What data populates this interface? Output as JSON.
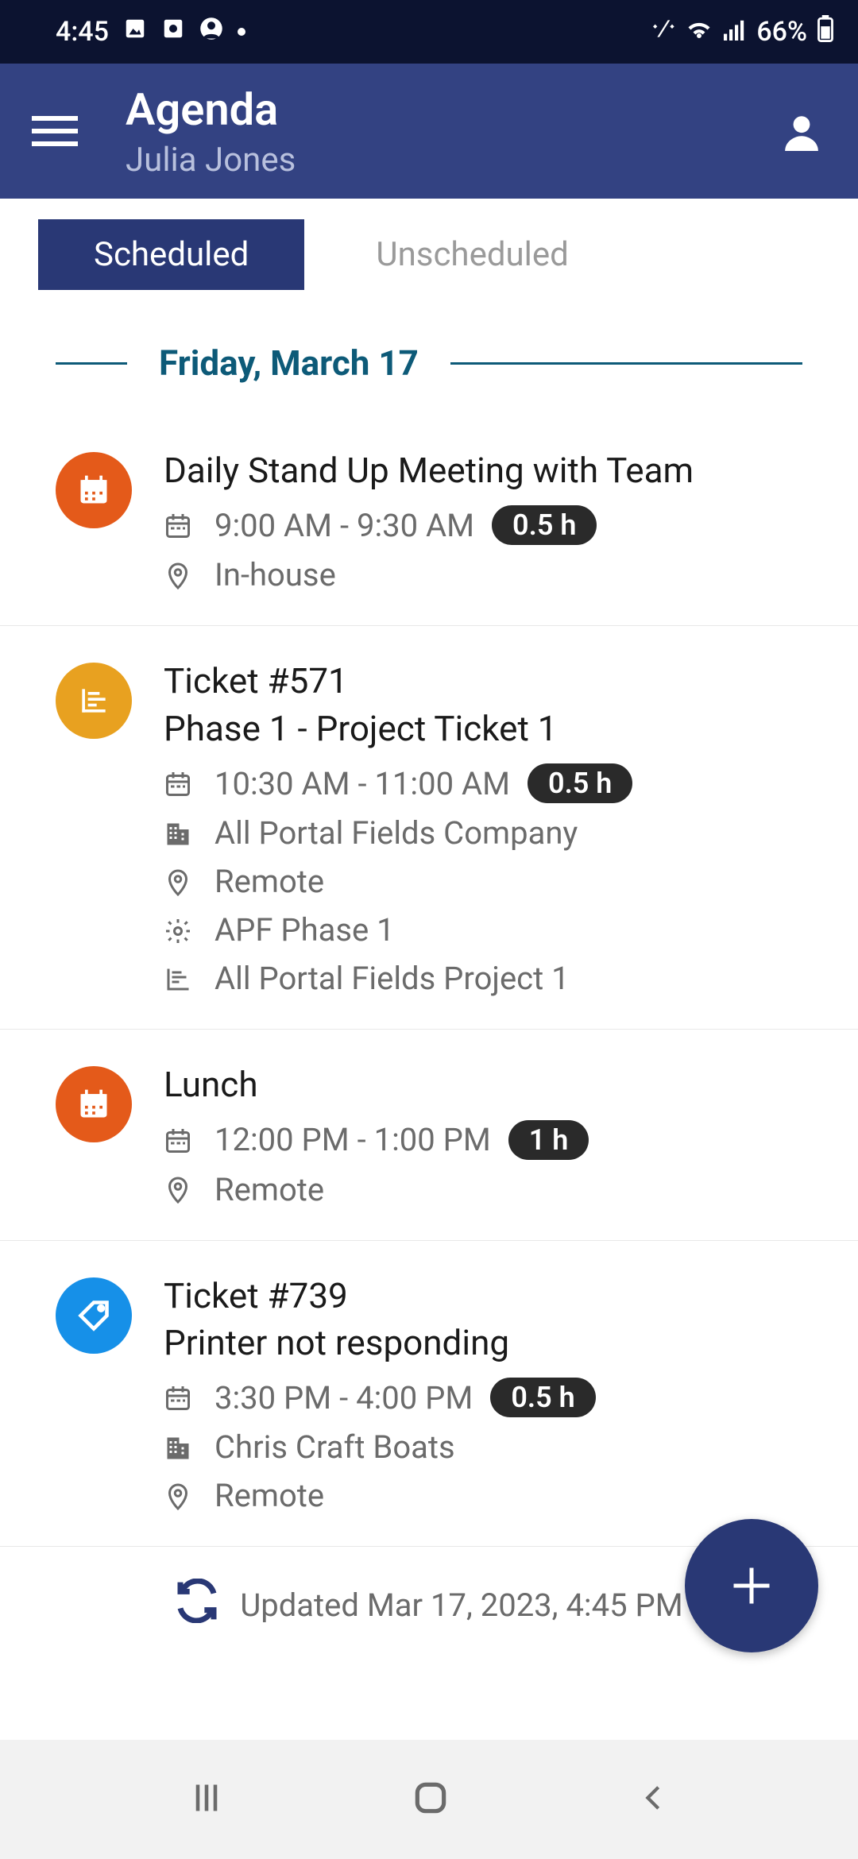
{
  "status": {
    "time": "4:45",
    "battery": "66%"
  },
  "header": {
    "title": "Agenda",
    "user": "Julia Jones"
  },
  "tabs": {
    "scheduled": "Scheduled",
    "unscheduled": "Unscheduled"
  },
  "date": "Friday, March 17",
  "items": [
    {
      "iconClass": "icon-orange",
      "iconType": "calendar",
      "title": "Daily Stand Up Meeting with Team",
      "subtitle": "",
      "time": "9:00 AM - 9:30 AM",
      "duration": "0.5 h",
      "company": "",
      "location": "In-house",
      "phase": "",
      "project": ""
    },
    {
      "iconClass": "icon-amber",
      "iconType": "project",
      "title": "Ticket #571",
      "subtitle": "Phase 1 - Project Ticket 1",
      "time": "10:30 AM - 11:00 AM",
      "duration": "0.5 h",
      "company": "All Portal Fields Company",
      "location": "Remote",
      "phase": "APF Phase 1",
      "project": "All Portal Fields Project 1"
    },
    {
      "iconClass": "icon-orange",
      "iconType": "calendar",
      "title": "Lunch",
      "subtitle": "",
      "time": "12:00 PM - 1:00 PM",
      "duration": "1 h",
      "company": "",
      "location": "Remote",
      "phase": "",
      "project": ""
    },
    {
      "iconClass": "icon-blue",
      "iconType": "tag",
      "title": "Ticket #739",
      "subtitle": "Printer not responding",
      "time": "3:30 PM - 4:00 PM",
      "duration": "0.5 h",
      "company": "Chris Craft Boats",
      "location": "Remote",
      "phase": "",
      "project": ""
    }
  ],
  "updated": "Updated Mar 17, 2023, 4:45 PM"
}
